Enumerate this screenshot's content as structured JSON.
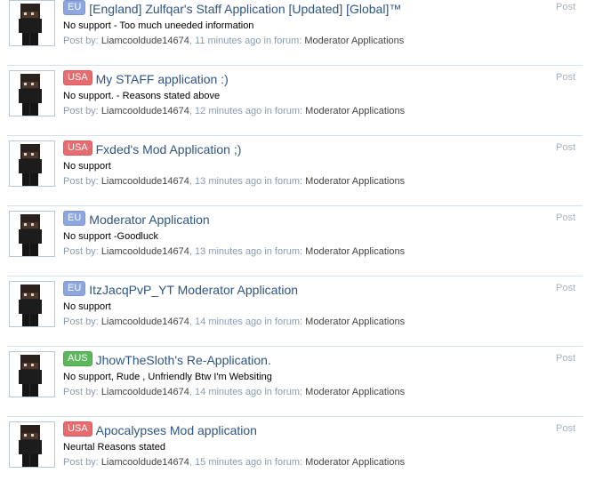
{
  "labels": {
    "post_type": "Post",
    "posted_by": "Post by:",
    "in_forum": "in forum:"
  },
  "prefix_colors": {
    "EU": "#8ea6e0",
    "USA": "#e86b70",
    "AUS": "#5cb85c"
  },
  "results": [
    {
      "prefix": "EU",
      "title": "[England] Zulfqar's Staff Application [Updated] [Global]™",
      "snippet": "No support - Too much uneeded information",
      "author": "Liamcooldude14674",
      "time": "11 minutes ago",
      "forum": "Moderator Applications"
    },
    {
      "prefix": "USA",
      "title": "My STAFF application :)",
      "snippet": "No support. - Reasons stated above",
      "author": "Liamcooldude14674",
      "time": "12 minutes ago",
      "forum": "Moderator Applications"
    },
    {
      "prefix": "USA",
      "title": "Fxded's Mod Application ;)",
      "snippet": "No support",
      "author": "Liamcooldude14674",
      "time": "13 minutes ago",
      "forum": "Moderator Applications"
    },
    {
      "prefix": "EU",
      "title": "Moderator Application",
      "snippet": "No support -Goodluck",
      "author": "Liamcooldude14674",
      "time": "13 minutes ago",
      "forum": "Moderator Applications"
    },
    {
      "prefix": "EU",
      "title": "ItzJacqPvP_YT Moderator Application",
      "snippet": "No support",
      "author": "Liamcooldude14674",
      "time": "14 minutes ago",
      "forum": "Moderator Applications"
    },
    {
      "prefix": "AUS",
      "title": "JhowTheSloth's Re-Application.",
      "snippet": "No support, Rude , Unfriendly Btw I'm Websiting",
      "author": "Liamcooldude14674",
      "time": "14 minutes ago",
      "forum": "Moderator Applications"
    },
    {
      "prefix": "USA",
      "title": "Apocalypses Mod application",
      "snippet": "Neurtal Reasons stated",
      "author": "Liamcooldude14674",
      "time": "15 minutes ago",
      "forum": "Moderator Applications"
    }
  ]
}
